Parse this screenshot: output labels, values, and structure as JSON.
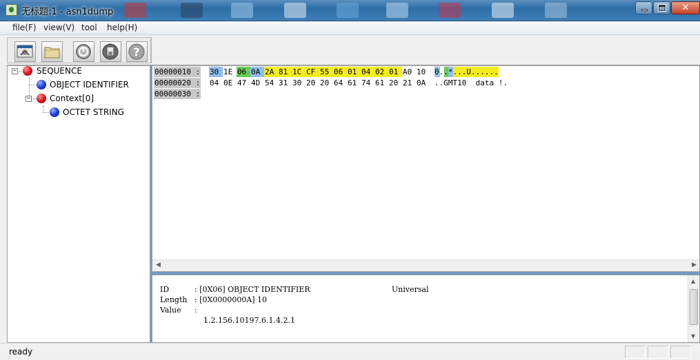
{
  "window": {
    "title": "无标题:1 - asn1dump",
    "controls": {
      "minimize": "",
      "maximize": "",
      "close": "✕"
    }
  },
  "menu": [
    {
      "label": "file(F)"
    },
    {
      "label": "view(V)"
    },
    {
      "label": "tool"
    },
    {
      "label": "help(H)"
    }
  ],
  "toolbar": {
    "buttons": [
      {
        "icon": "parse-icon"
      },
      {
        "icon": "folder-open-icon"
      },
      {
        "icon": "power-icon"
      },
      {
        "icon": "disk-icon"
      },
      {
        "icon": "help-icon"
      }
    ]
  },
  "tree": {
    "nodes": [
      {
        "label": "SEQUENCE",
        "type": "constructed",
        "expanded": true,
        "toggle": "−"
      },
      {
        "label": "OBJECT IDENTIFIER",
        "type": "primitive"
      },
      {
        "label": "Context[0]",
        "type": "constructed",
        "expanded": true,
        "toggle": "−"
      },
      {
        "label": "OCTET STRING",
        "type": "primitive"
      }
    ]
  },
  "hex": {
    "rows": [
      {
        "offset": "00000010 :",
        "bytes": [
          "30",
          "1E",
          "06",
          "0A",
          "2A",
          "81",
          "1C",
          "CF",
          "55",
          "06",
          "01",
          "04",
          "02",
          "01",
          "A0",
          "10"
        ],
        "highlights": [
          "blue",
          "none",
          "green",
          "blue",
          "yellow",
          "yellow",
          "yellow",
          "yellow",
          "yellow",
          "yellow",
          "yellow",
          "yellow",
          "yellow",
          "yellow",
          "none",
          "none"
        ],
        "ascii": "0..*...U......"
      },
      {
        "offset": "00000020 :",
        "bytes": [
          "04",
          "0E",
          "47",
          "4D",
          "54",
          "31",
          "30",
          "20",
          "20",
          "64",
          "61",
          "74",
          "61",
          "20",
          "21",
          "0A"
        ],
        "highlights": [],
        "ascii": "..GMT10  data !."
      },
      {
        "offset": "00000030 :",
        "bytes": [],
        "highlights": [],
        "ascii": ""
      }
    ],
    "colors": {
      "blue": "#8fbdf2",
      "green": "#66cc55",
      "yellow": "#f5ec1c",
      "offset_bg": "#c8c8c8"
    }
  },
  "info": {
    "id_label": "ID",
    "id_value": ": [0X06] OBJECT IDENTIFIER",
    "class": "Universal",
    "length_label": "Length",
    "length_value": ": [0X0000000A] 10",
    "value_label": "Value",
    "value_sep": ":",
    "value": "1.2.156.10197.6.1.4.2.1"
  },
  "status": {
    "text": "ready"
  }
}
